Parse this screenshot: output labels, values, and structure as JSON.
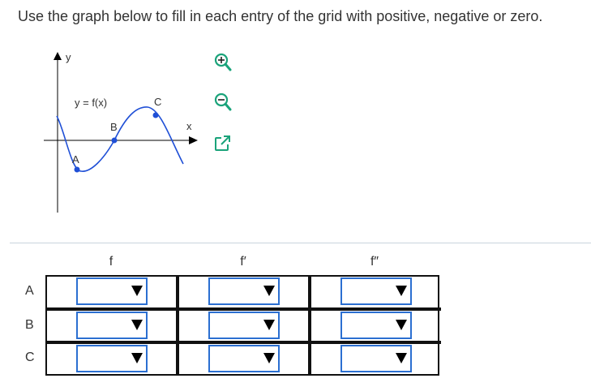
{
  "instruction": "Use the graph below to fill in each entry of the grid with positive, negative or zero.",
  "graph": {
    "y_axis_label": "y",
    "x_axis_label": "x",
    "function_label": "y = f(x)",
    "points": [
      "A",
      "B",
      "C"
    ]
  },
  "tools": [
    {
      "name": "zoom-in",
      "icon": "magnifier-plus"
    },
    {
      "name": "zoom-out",
      "icon": "magnifier-minus"
    },
    {
      "name": "expand",
      "icon": "open-external"
    }
  ],
  "grid": {
    "columns": [
      "f",
      "f′",
      "f″"
    ],
    "rows": [
      {
        "label": "A",
        "f": "",
        "f_prime": "",
        "f_double_prime": ""
      },
      {
        "label": "B",
        "f": "",
        "f_prime": "",
        "f_double_prime": ""
      },
      {
        "label": "C",
        "f": "",
        "f_prime": "",
        "f_double_prime": ""
      }
    ]
  },
  "colors": {
    "curve": "#1f4fd6",
    "select_border": "#2b6fd1",
    "tool_icon": "#1aa37a"
  }
}
